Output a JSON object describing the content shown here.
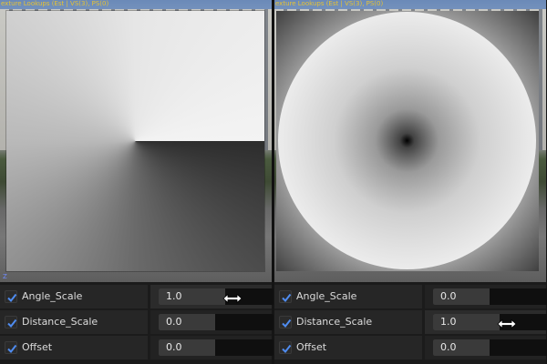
{
  "viewports": [
    {
      "title": "exture Lookups (Est | VS(3), PS(0)",
      "preview": "angle-lookup"
    },
    {
      "title": "exture Lookups (Est | VS(3), PS(0)",
      "preview": "distance-lookup"
    }
  ],
  "axis_label": "Z",
  "panels": [
    {
      "params": [
        {
          "name": "Angle_Scale",
          "value": "1.0",
          "checked": true,
          "fill": 0.58,
          "drag_cursor": true
        },
        {
          "name": "Distance_Scale",
          "value": "0.0",
          "checked": true,
          "fill": 0.49,
          "drag_cursor": false
        },
        {
          "name": "Offset",
          "value": "0.0",
          "checked": true,
          "fill": 0.49,
          "drag_cursor": false
        }
      ]
    },
    {
      "params": [
        {
          "name": "Angle_Scale",
          "value": "0.0",
          "checked": true,
          "fill": 0.49,
          "drag_cursor": false
        },
        {
          "name": "Distance_Scale",
          "value": "1.0",
          "checked": true,
          "fill": 0.58,
          "drag_cursor": true
        },
        {
          "name": "Offset",
          "value": "0.0",
          "checked": true,
          "fill": 0.49,
          "drag_cursor": false
        }
      ]
    }
  ],
  "colors": {
    "check": "#4f8cf0",
    "title": "#e6c234",
    "axis": "#6f8bff"
  },
  "icons": {
    "checkbox": "checkmark-icon",
    "cursor": "horizontal-resize-cursor-icon"
  }
}
